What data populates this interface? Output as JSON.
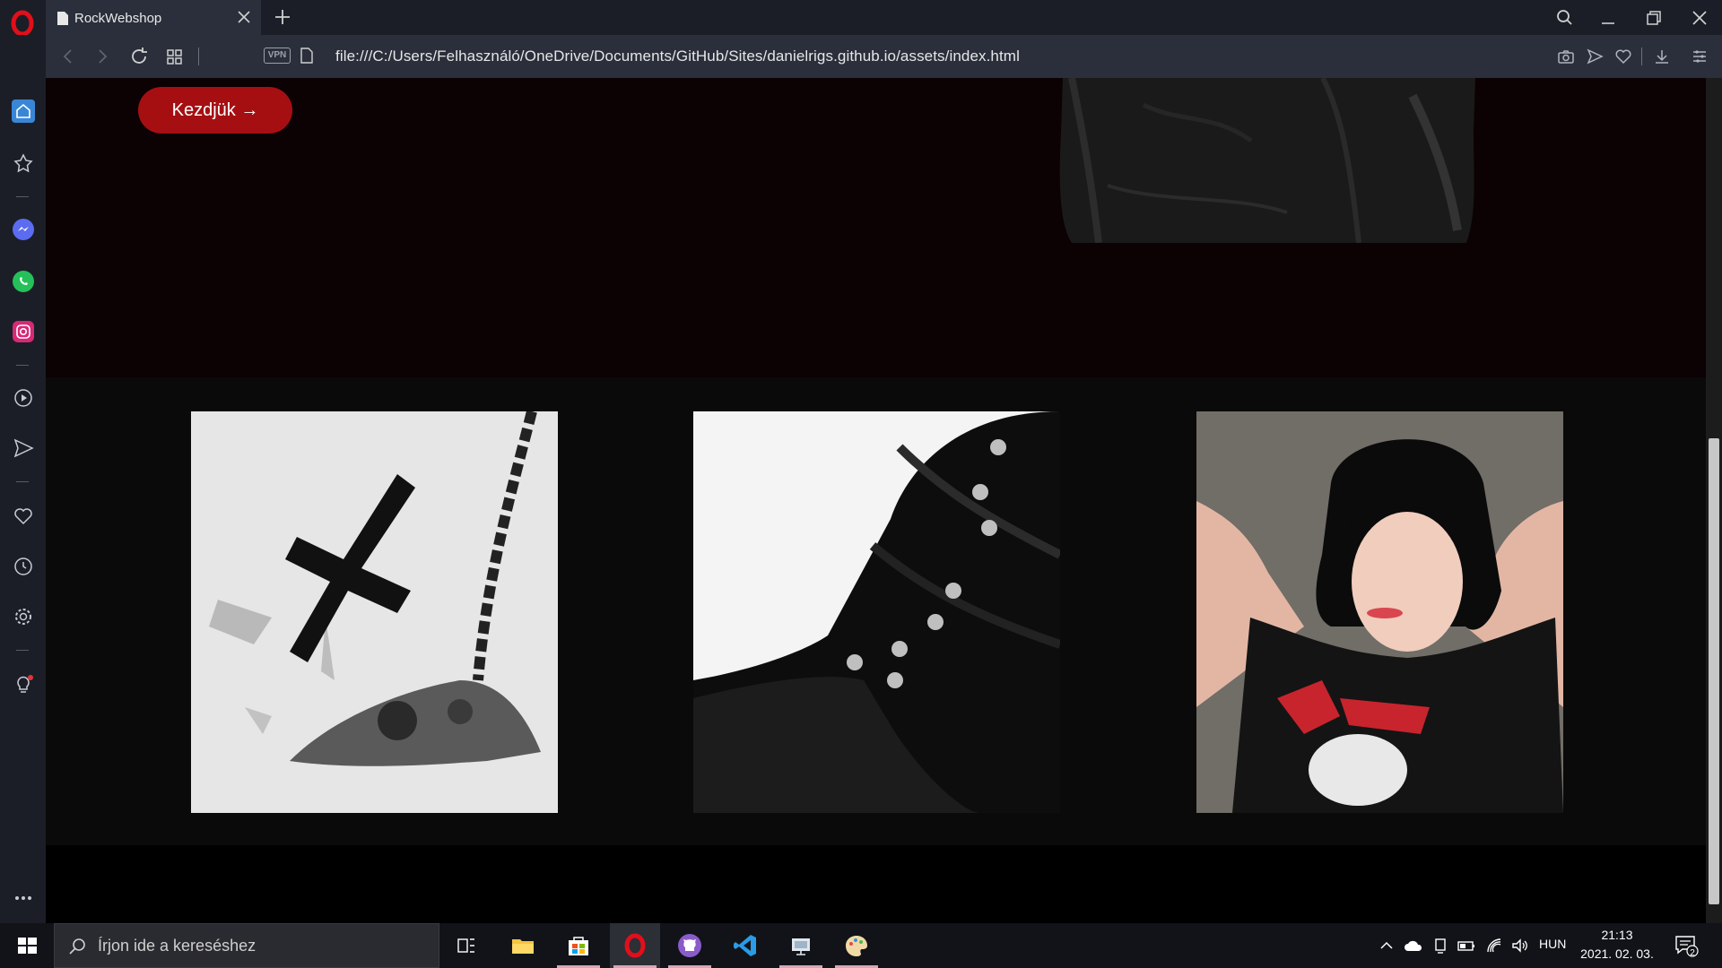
{
  "browser": {
    "tab_title": "RockWebshop",
    "url": "file:///C:/Users/Felhasználó/OneDrive/Documents/GitHub/Sites/danielrigs.github.io/assets/index.html",
    "vpn_label": "VPN"
  },
  "page": {
    "cta_label": "Kezdjük →",
    "gallery": [
      "inverted cross necklace photo",
      "black leather boots photo",
      "woman in band t-shirt photo"
    ]
  },
  "taskbar": {
    "search_placeholder": "Írjon ide a kereséshez",
    "language": "HUN",
    "time": "21:13",
    "date": "2021. 02. 03.",
    "notification_count": "2"
  },
  "colors": {
    "accent": "#a60f12",
    "chrome": "#1b1e27",
    "addressbar": "#2a2f3b",
    "hero_bg": "#0c0103",
    "gallery_bg": "#0a0a0a"
  }
}
